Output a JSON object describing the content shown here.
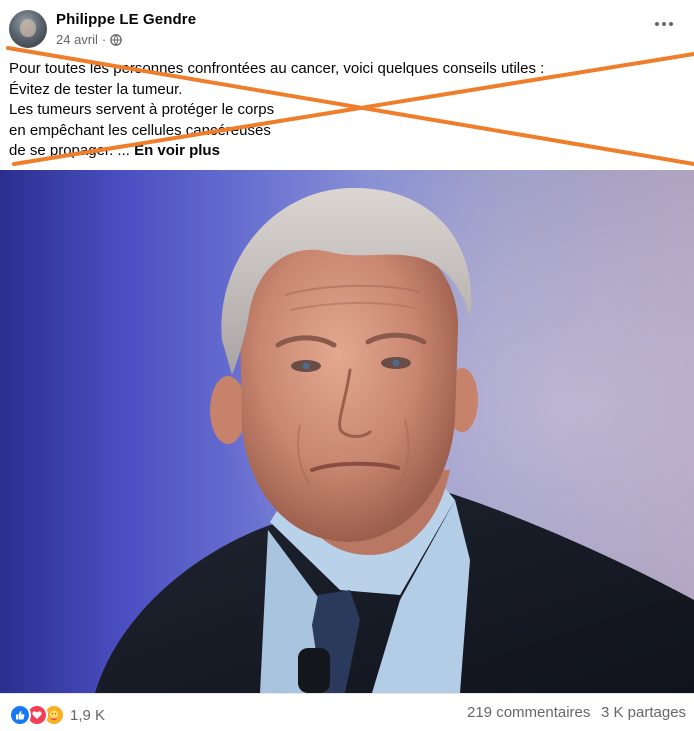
{
  "post": {
    "author": "Philippe LE Gendre",
    "date": "24 avril",
    "date_separator": "·",
    "privacy_icon": "globe-icon",
    "text_lines": [
      "Pour toutes les personnes confrontées au cancer, voici quelques conseils utiles :",
      "Évitez de tester la tumeur.",
      "Les tumeurs servent à protéger le corps",
      "en empêchant les cellules cancéreuses",
      "de se propager. ..."
    ],
    "see_more": "En voir plus"
  },
  "annotation": {
    "cross_color": "#f07d2a"
  },
  "engagement": {
    "reaction_icons": [
      "like-icon",
      "love-icon",
      "care-icon"
    ],
    "reaction_count": "1,9 K",
    "comments": "219 commentaires",
    "shares": "3 K partages"
  },
  "colors": {
    "like": "#1877f2",
    "love": "#f33e58",
    "care": "#f7b125",
    "secondary_text": "#65676b"
  }
}
